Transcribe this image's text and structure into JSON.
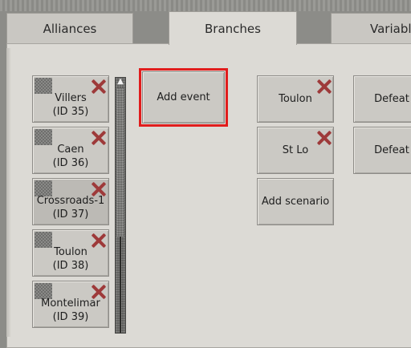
{
  "tabs": [
    {
      "label": "Alliances",
      "active": false
    },
    {
      "label": "Branches",
      "active": true
    },
    {
      "label": "Variable",
      "active": false
    }
  ],
  "scenario_list": [
    {
      "name": "Villers",
      "id": "(ID 35)"
    },
    {
      "name": "Caen",
      "id": "(ID 36)"
    },
    {
      "name": "Crossroads-1",
      "id": "(ID 37)"
    },
    {
      "name": "Toulon",
      "id": "(ID 38)"
    },
    {
      "name": "Montelimar",
      "id": "(ID 39)"
    }
  ],
  "add_event_label": "Add event",
  "branch_column": {
    "items": [
      "Toulon",
      "St Lo"
    ],
    "add_scenario_label": "Add scenario"
  },
  "outcome_column": {
    "items": [
      "Defeat",
      "Defeat"
    ]
  },
  "scroll_up_glyph": "▲",
  "colors": {
    "highlight": "#e11d1d",
    "delete_x": "#9e3a3a"
  }
}
